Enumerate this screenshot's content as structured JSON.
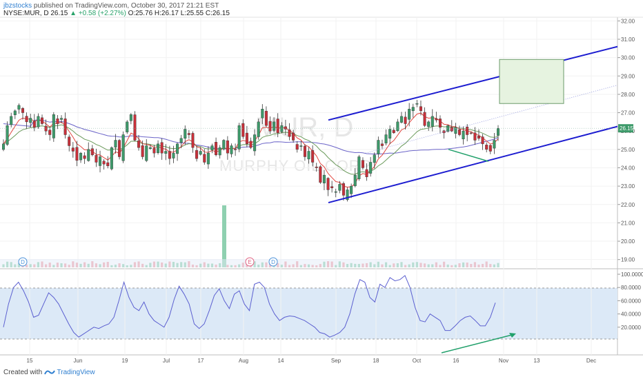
{
  "header": {
    "user": "jbzstocks",
    "published": "published on TradingView.com, October 30, 2017 21:21 EST",
    "symbol_line_prefix": "NYSE:MUR, D  26.15",
    "change": "+0.58 (+2.27%)",
    "ohlc": "O:25.76 H:26.17 L:25.55 C:26.15"
  },
  "footer": {
    "created_with": "Created with",
    "brand": "TradingView"
  },
  "watermark": {
    "ticker": "MUR, D",
    "name": "MURPHY OIL CORP"
  },
  "colors": {
    "up": "#3d9a6a",
    "down": "#c8303a",
    "channel": "#1c1cd0",
    "sma_blue": "#6a63c8",
    "ema_red": "#e2463f",
    "ema_green": "#6a9a5a",
    "stoch": "#5b5fd0",
    "band_fill": "#dce9f7",
    "volume_up": "#8fd0b0",
    "volume_down": "#f0a0a8",
    "arrow": "#21a06b",
    "target_box": "#e6f3e0"
  },
  "chart_data": [
    {
      "type": "candlestick",
      "symbol": "NYSE:MUR",
      "interval": "D",
      "ylim": [
        18.5,
        32.2
      ],
      "y_ticks": [
        "32.00",
        "31.00",
        "30.00",
        "29.00",
        "28.00",
        "27.00",
        "26.00",
        "25.00",
        "24.00",
        "23.00",
        "22.00",
        "21.00",
        "20.00",
        "19.00"
      ],
      "x_ticks": [
        "15",
        "Jun",
        "19",
        "Jul",
        "17",
        "Aug",
        "14",
        "Sep",
        "18",
        "Oct",
        "16",
        "Nov",
        "13",
        "Dec"
      ],
      "last_price": "26.15",
      "closes": [
        25.3,
        26.3,
        26.8,
        27.1,
        27.4,
        27.0,
        26.5,
        26.7,
        26.2,
        26.8,
        26.4,
        26.0,
        25.8,
        26.9,
        26.4,
        26.7,
        25.8,
        25.2,
        24.9,
        24.4,
        24.8,
        24.5,
        25.0,
        24.7,
        24.3,
        24.6,
        24.2,
        24.1,
        25.1,
        25.5,
        24.6,
        25.8,
        26.5,
        26.9,
        25.5,
        25.1,
        24.6,
        25.2,
        25.1,
        24.8,
        25.3,
        24.8,
        24.9,
        24.5,
        24.8,
        25.3,
        25.6,
        26.1,
        25.8,
        25.1,
        24.5,
        24.9,
        24.3,
        24.8,
        25.2,
        24.7,
        25.1,
        25.5,
        24.8,
        25.2,
        25.0,
        26.3,
        25.7,
        25.3,
        25.1,
        25.8,
        26.5,
        27.2,
        26.3,
        26.0,
        26.5,
        25.9,
        26.3,
        26.1,
        25.7,
        25.5,
        25.0,
        25.2,
        24.6,
        24.9,
        24.3,
        24.0,
        23.2,
        23.6,
        22.8,
        22.9,
        22.7,
        23.1,
        22.5,
        22.8,
        23.0,
        23.6,
        24.6,
        24.0,
        23.5,
        24.3,
        24.7,
        25.5,
        25.2,
        25.8,
        26.1,
        25.9,
        26.5,
        26.8,
        26.4,
        27.2,
        27.3,
        27.5,
        27.1,
        26.3,
        26.5,
        26.8,
        26.6,
        26.2,
        25.9,
        26.3,
        26.0,
        26.2,
        25.8,
        26.0,
        25.8,
        25.9,
        25.5,
        25.6,
        25.3,
        25.0,
        24.9,
        25.5,
        26.15
      ],
      "events": [
        "D",
        "E",
        "D"
      ]
    },
    {
      "type": "trendlines",
      "lines": [
        {
          "name": "channel-top",
          "from": [
            22.5,
            26.6
          ],
          "to": "right edge 30.5"
        },
        {
          "name": "channel-bottom",
          "from": [
            22.2
          ],
          "to": "right edge 26.25"
        }
      ],
      "target_zone": {
        "low": 27.5,
        "high": 29.9
      }
    },
    {
      "type": "line",
      "indicator": "Stochastic",
      "ylim": [
        0,
        100
      ],
      "y_ticks": [
        "100.0000",
        "80.0000",
        "60.0000",
        "40.0000",
        "20.0000"
      ],
      "upper_band": 80,
      "lower_band": 20,
      "values": [
        20,
        55,
        80,
        88,
        75,
        58,
        35,
        38,
        55,
        72,
        65,
        55,
        40,
        25,
        12,
        5,
        10,
        15,
        20,
        18,
        22,
        25,
        35,
        60,
        88,
        65,
        50,
        45,
        58,
        40,
        30,
        25,
        20,
        35,
        62,
        82,
        70,
        55,
        25,
        18,
        25,
        45,
        68,
        78,
        60,
        48,
        70,
        75,
        55,
        45,
        85,
        88,
        80,
        55,
        40,
        30,
        35,
        37,
        36,
        33,
        30,
        25,
        20,
        12,
        10,
        5,
        8,
        12,
        20,
        40,
        70,
        92,
        88,
        65,
        58,
        85,
        80,
        95,
        90,
        92,
        98,
        80,
        50,
        30,
        28,
        40,
        35,
        30,
        15,
        15,
        22,
        30,
        35,
        37,
        30,
        22,
        22,
        35,
        57
      ]
    }
  ]
}
